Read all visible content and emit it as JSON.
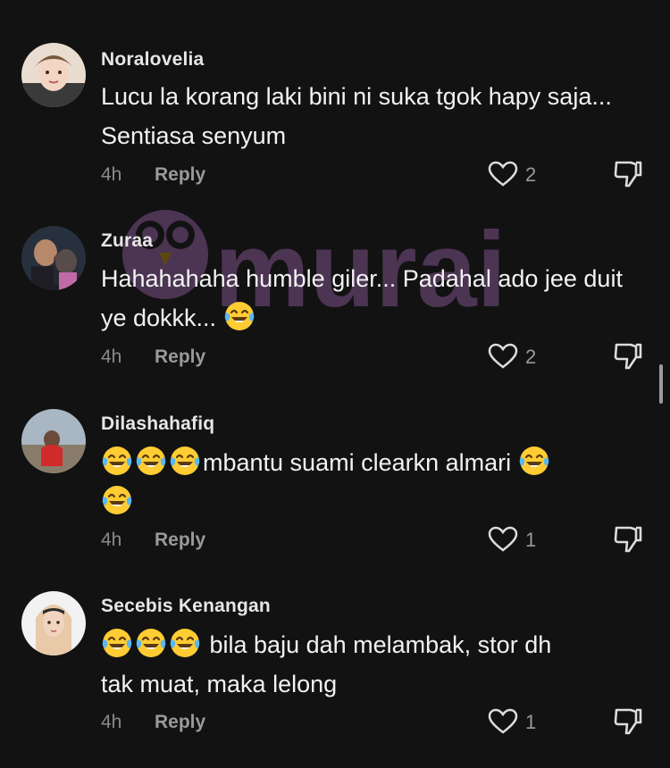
{
  "comments": [
    {
      "username": "Noralovelia",
      "text": "Lucu la korang laki bini ni suka tgok hapy saja... Sentiasa senyum",
      "time": "4h",
      "reply": "Reply",
      "likes": "2"
    },
    {
      "username": "Zuraa",
      "text": "Hahahahaha humble giler... Padahal ado jee duit ye dokkk...",
      "time": "4h",
      "reply": "Reply",
      "likes": "2"
    },
    {
      "username": "Dilashahafiq",
      "text_mid": "mbantu suami clearkn almari",
      "time": "4h",
      "reply": "Reply",
      "likes": "1"
    },
    {
      "username": "Secebis Kenangan",
      "text_line1": " bila baju dah melambak, stor dh",
      "text_line2": "tak muat, maka lelong",
      "time": "4h",
      "reply": "Reply",
      "likes": "1"
    }
  ],
  "watermark": {
    "text": "murai"
  },
  "icons": {
    "like": "heart-outline-icon",
    "dislike": "thumbs-down-icon",
    "emoji": "face-with-tears-of-joy-icon"
  },
  "colors": {
    "background": "#121212",
    "watermark": "#c17dd6"
  }
}
